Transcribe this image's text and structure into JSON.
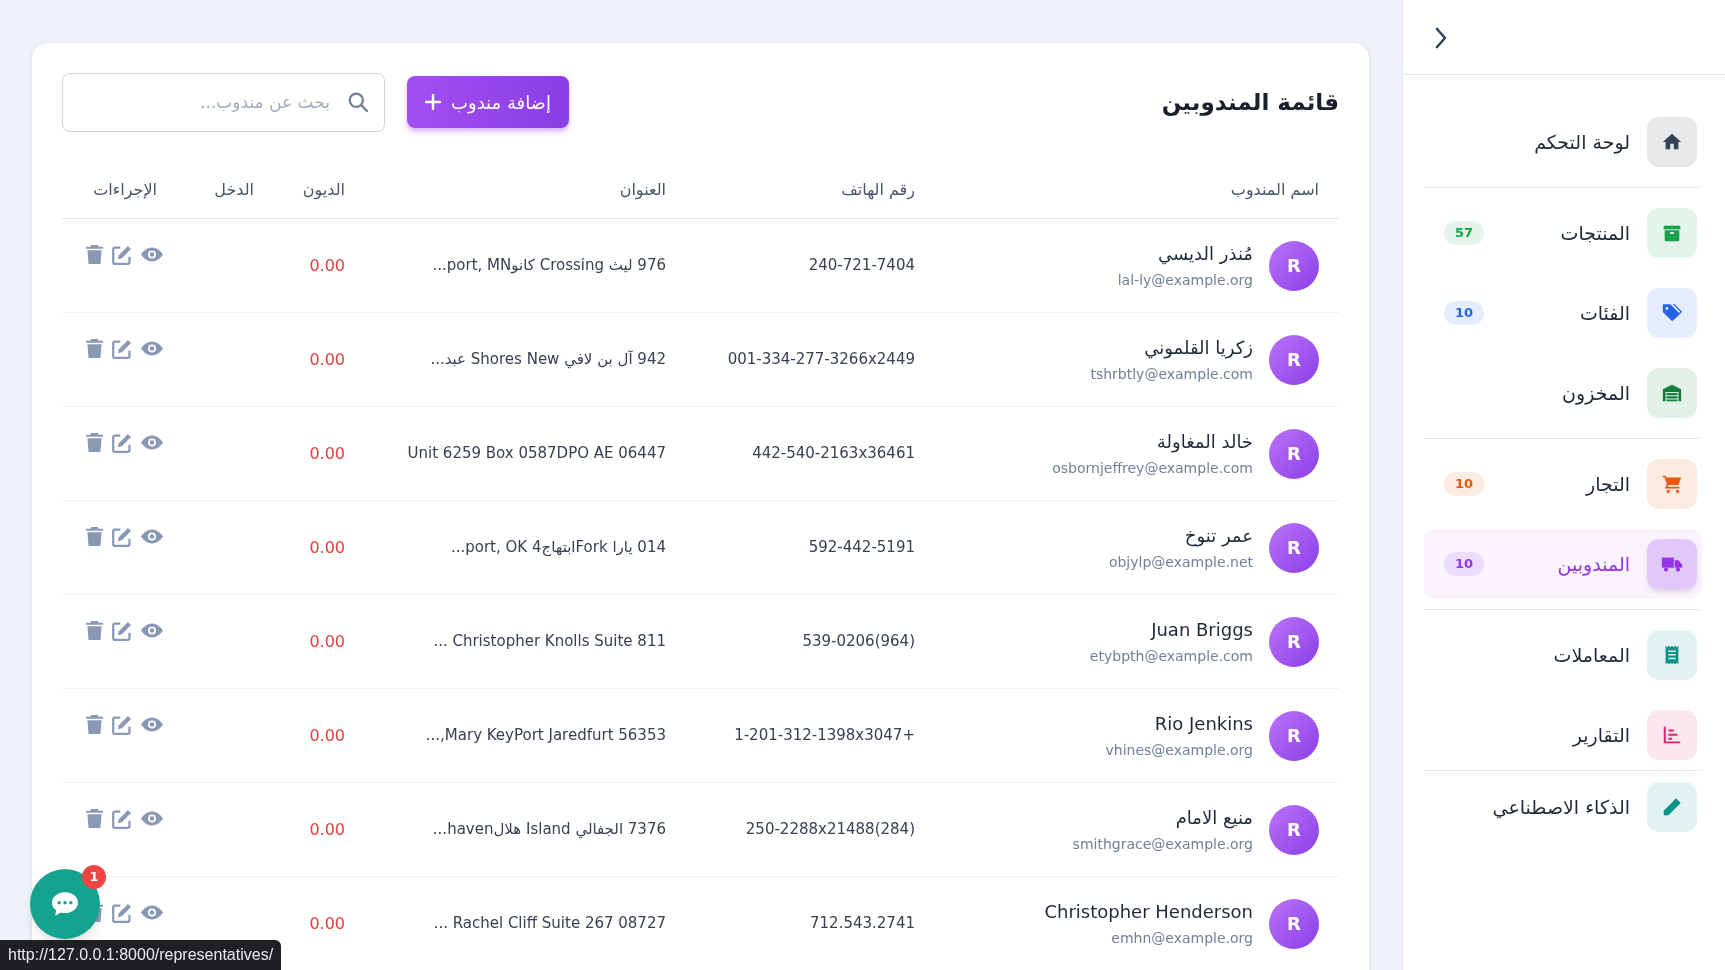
{
  "sidebar": {
    "groups": [
      {
        "items": [
          {
            "label": "لوحة التحكم",
            "selected": false,
            "color": "#334155"
          }
        ]
      },
      {
        "items": [
          {
            "label": "المنتجات",
            "badge": "57",
            "selected": false,
            "color": "#16a34a"
          },
          {
            "label": "الفئات",
            "badge": "10",
            "selected": false,
            "color": "#2563eb"
          },
          {
            "label": "المخزون",
            "selected": false,
            "color": "#15803d"
          }
        ]
      },
      {
        "items": [
          {
            "label": "التجار",
            "badge": "10",
            "selected": false,
            "color": "#ea580c"
          },
          {
            "label": "المندوبين",
            "badge": "10",
            "selected": true,
            "color": "#9333ea"
          }
        ]
      },
      {
        "items": [
          {
            "label": "المعاملات",
            "selected": false,
            "color": "#0d9488"
          },
          {
            "label": "التقارير",
            "selected": false,
            "color": "#db2777"
          }
        ]
      },
      {
        "items": [
          {
            "label": "الذكاء الاصطناعي",
            "selected": false,
            "color": "#0d9488"
          }
        ]
      }
    ]
  },
  "main": {
    "title": "قائمة المندوبين",
    "add_button": "إضافة مندوب",
    "search": {
      "placeholder": "بحث عن مندوب..."
    },
    "table": {
      "columns": [
        "اسم المندوب",
        "رقم الهاتف",
        "العنوان",
        "الديون",
        "الدخل",
        "الإجراءات"
      ],
      "rows": [
        {
          "initial": "R",
          "name": "مُنذر الديسي",
          "email": "lal-ly@example.org",
          "phone": "240-721-7404",
          "address": "976 ليث Crossing كانوport, MN...",
          "debts": "0.00"
        },
        {
          "initial": "R",
          "name": "زكريا القلموني",
          "email": "tshrbtly@example.com",
          "phone": "001-334-277-3266x2449",
          "address": "942 آل بن لافي Shores New عبد...",
          "debts": "0.00"
        },
        {
          "initial": "R",
          "name": "خالد المغاولة",
          "email": "osbornjeffrey@example.com",
          "phone": "442-540-2163x36461",
          "address": "Unit 6259 Box 0587DPO AE 06447",
          "debts": "0.00"
        },
        {
          "initial": "R",
          "name": "عمر تنوخ",
          "email": "objylp@example.net",
          "phone": "592-442-5191",
          "address": "014 يارا Forkابتهاج4 port, OK...",
          "debts": "0.00"
        },
        {
          "initial": "R",
          "name": "Juan Briggs",
          "email": "etybpth@example.com",
          "phone": "(964)539-0206",
          "address": "Christopher Knolls Suite 811 ...",
          "debts": "0.00"
        },
        {
          "initial": "R",
          "name": "Rio Jenkins",
          "email": "vhines@example.org",
          "phone": "+1-201-312-1398x3047",
          "address": "Mary KeyPort Jaredfurt 56353,...",
          "debts": "0.00"
        },
        {
          "initial": "R",
          "name": "منيع الامام",
          "email": "smithgrace@example.org",
          "phone": "(284)250-2288x21488",
          "address": "7376 الجفالي Island هلالhaven...",
          "debts": "0.00"
        },
        {
          "initial": "R",
          "name": "Christopher Henderson",
          "email": "emhn@example.org",
          "phone": "712.543.2741",
          "address": "Rachel Cliff Suite 267 08727 ...",
          "debts": "0.00"
        }
      ]
    }
  },
  "chat_widget": {
    "badge": "1"
  },
  "status_url": "http://127.0.0.1:8000/representatives/"
}
